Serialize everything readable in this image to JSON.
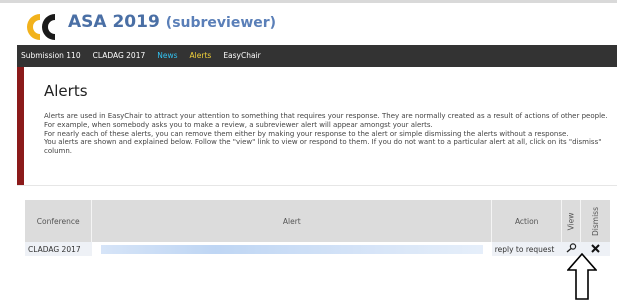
{
  "header": {
    "title": "ASA 2019",
    "role": "(subreviewer)",
    "logo_icon": "easychair-logo"
  },
  "menu": {
    "items": [
      {
        "label": "Submission 110"
      },
      {
        "label": "CLADAG 2017"
      },
      {
        "label": "News"
      },
      {
        "label": "Alerts"
      },
      {
        "label": "EasyChair"
      }
    ]
  },
  "page": {
    "title": "Alerts",
    "paragraphs": [
      "Alerts are used in EasyChair to attract your attention to something that requires your response. They are normally created as a result of actions of other people. For example, when somebody asks you to make a review, a subreviewer alert will appear amongst your alerts.",
      "For nearly each of these alerts, you can remove them either by making your response to the alert or simple dismissing the alerts without a response.",
      "You alerts are shown and explained below. Follow the \"view\" link to view or respond to them. If you do not want to a particular alert at all, click on its \"dismiss\" column."
    ]
  },
  "table": {
    "headers": {
      "conference": "Conference",
      "alert": "Alert",
      "action": "Action",
      "view": "View",
      "dismiss": "Dismiss"
    },
    "rows": [
      {
        "conference": "CLADAG 2017",
        "action": "reply to request",
        "view_icon": "magnifier-icon",
        "dismiss_icon": "close-icon"
      }
    ]
  },
  "colors": {
    "title": "#4a6fa5",
    "menubar": "#333333",
    "news": "#33c2f0",
    "alerts": "#f3d23a",
    "content_border": "#8b1a1a"
  }
}
